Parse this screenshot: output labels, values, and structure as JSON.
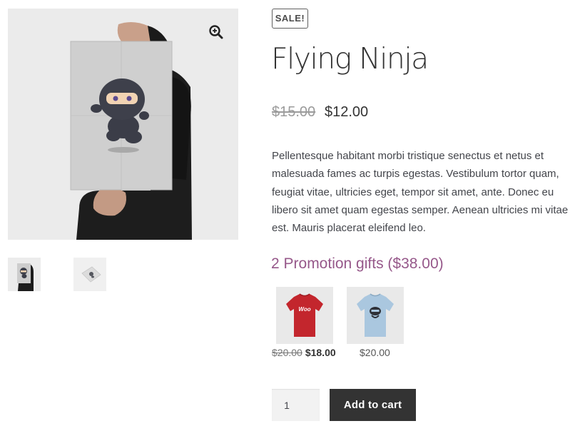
{
  "product": {
    "sale_badge": "SALE!",
    "title": "Flying Ninja",
    "price_old": "$15.00",
    "price_new": "$12.00",
    "description": "Pellentesque habitant morbi tristique senectus et netus et malesuada fames ac turpis egestas. Vestibulum tortor quam, feugiat vitae, ultricies eget, tempor sit amet, ante. Donec eu libero sit amet quam egestas semper. Aenean ultricies mi vitae est. Mauris placerat eleifend leo."
  },
  "gallery": {
    "zoom_icon": "zoom-in-icon",
    "thumbnails": [
      "poster-held-thumbnail",
      "poster-flat-thumbnail"
    ]
  },
  "promotion": {
    "title": "2 Promotion gifts ($38.00)",
    "gifts": [
      {
        "image": "red-woo-tshirt",
        "price_old": "$20.00",
        "price_new": "$18.00"
      },
      {
        "image": "light-blue-ninja-tshirt",
        "price": "$20.00"
      }
    ]
  },
  "cart": {
    "quantity": "1",
    "add_label": "Add to cart"
  },
  "colors": {
    "promo_title": "#96588a",
    "button_bg": "#333333"
  }
}
